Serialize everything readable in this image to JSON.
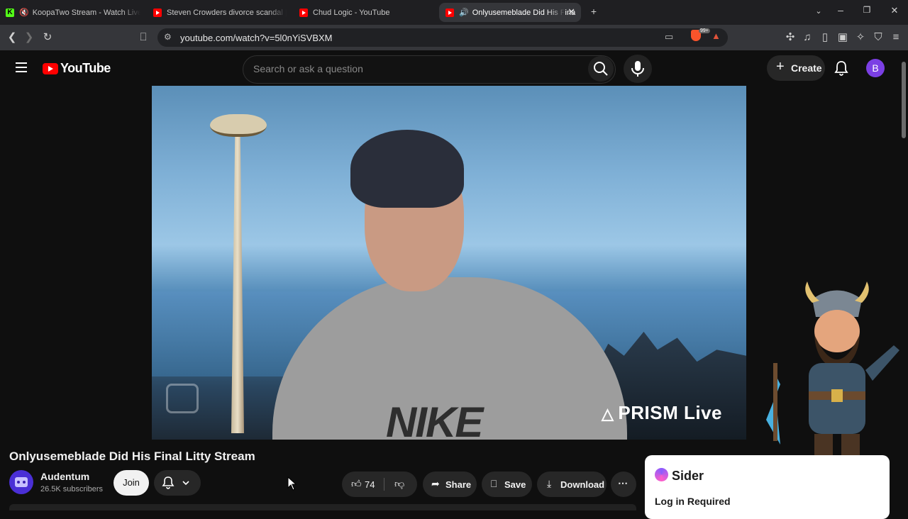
{
  "browser": {
    "tabs": [
      {
        "title": "KoopaTwo Stream - Watch Live o",
        "icon": "kick-icon",
        "muted": true
      },
      {
        "title": "Steven Crowders divorce scandal | RE",
        "icon": "youtube-icon"
      },
      {
        "title": "Chud Logic - YouTube",
        "icon": "youtube-icon"
      },
      {
        "title": "Onlyusemeblade Did His Fina",
        "icon": "youtube-icon",
        "active": true,
        "audio": true
      }
    ],
    "url": "youtube.com/watch?v=5l0nYiSVBXM",
    "brave_badge": "99+"
  },
  "header": {
    "logo_text": "YouTube",
    "search_placeholder": "Search or ask a question",
    "create_label": "Create",
    "avatar_letter": "B"
  },
  "video": {
    "watermark": "PRISM Live",
    "title": "Onlyusemeblade Did His Final Litty Stream"
  },
  "channel": {
    "name": "Audentum",
    "subscribers": "26.5K subscribers",
    "join_label": "Join"
  },
  "actions": {
    "likes": "74",
    "share": "Share",
    "save": "Save",
    "download": "Download"
  },
  "sider": {
    "name": "Sider",
    "login": "Log in Required"
  },
  "colors": {
    "background": "#0f0f0f",
    "brand_red": "#ff0000",
    "avatar_purple": "#7b3fe4",
    "pill_bg": "#272727"
  }
}
